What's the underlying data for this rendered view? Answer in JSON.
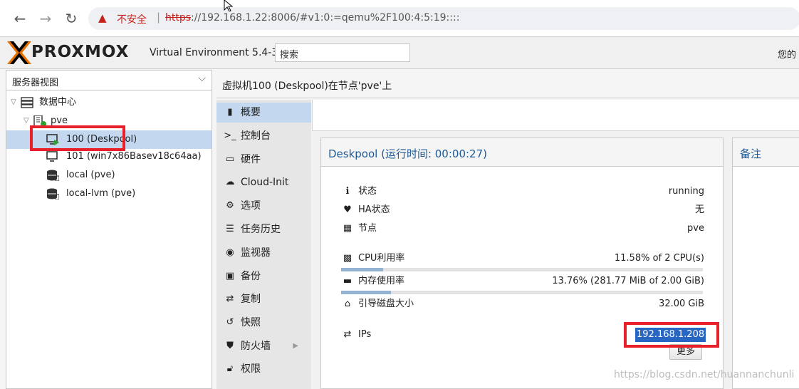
{
  "browser": {
    "back_icon": "←",
    "forward_icon": "→",
    "reload_icon": "↻",
    "insecure_label": "不安全",
    "url_scheme": "https",
    "url_rest": "://192.168.1.22:8006/#v1:0:=qemu%2F100:4:5:19::::"
  },
  "header": {
    "logo": "PROXMOX",
    "version": "Virtual Environment 5.4-3",
    "search_placeholder": "搜索",
    "user_label": "您的"
  },
  "tree": {
    "view_label": "服务器视图",
    "items": [
      {
        "label": "数据中心",
        "icon": "datacenter-icon"
      },
      {
        "label": "pve",
        "icon": "node-icon"
      },
      {
        "label": "100 (Deskpool)",
        "icon": "vm-running-icon"
      },
      {
        "label": "101 (win7x86Basev18c64aa)",
        "icon": "vm-icon"
      },
      {
        "label": "local (pve)",
        "icon": "storage-icon"
      },
      {
        "label": "local-lvm (pve)",
        "icon": "storage-icon"
      }
    ]
  },
  "content": {
    "title": "虚拟机100 (Deskpool)在节点'pve'上"
  },
  "subnav": [
    {
      "label": "概要",
      "icon": "book-icon"
    },
    {
      "label": "控制台",
      "icon": "terminal-icon"
    },
    {
      "label": "硬件",
      "icon": "monitor-icon"
    },
    {
      "label": "Cloud-Init",
      "icon": "cloud-icon"
    },
    {
      "label": "选项",
      "icon": "gear-icon"
    },
    {
      "label": "任务历史",
      "icon": "list-icon"
    },
    {
      "label": "监视器",
      "icon": "eye-icon"
    },
    {
      "label": "备份",
      "icon": "floppy-icon"
    },
    {
      "label": "复制",
      "icon": "retweet-icon"
    },
    {
      "label": "快照",
      "icon": "history-icon"
    },
    {
      "label": "防火墙",
      "icon": "shield-icon"
    },
    {
      "label": "权限",
      "icon": "unlock-icon"
    }
  ],
  "status": {
    "header": "Deskpool (运行时间: 00:00:27)",
    "rows": [
      {
        "label": "状态",
        "value": "running",
        "icon": "info-icon"
      },
      {
        "label": "HA状态",
        "value": "无",
        "icon": "heartbeat-icon"
      },
      {
        "label": "节点",
        "value": "pve",
        "icon": "building-icon"
      },
      {
        "label": "CPU利用率",
        "value": "11.58% of 2 CPU(s)",
        "icon": "cpu-icon"
      },
      {
        "label": "内存使用率",
        "value": "13.76% (281.77 MiB of 2.00 GiB)",
        "icon": "memory-icon"
      },
      {
        "label": "引导磁盘大小",
        "value": "32.00 GiB",
        "icon": "hdd-icon"
      },
      {
        "label": "IPs",
        "value": "",
        "icon": "exchange-icon"
      }
    ],
    "cpu_fraction": 0.1158,
    "mem_fraction": 0.1376,
    "ip": "192.168.1.208",
    "more_label": "更多"
  },
  "notes": {
    "header": "备注"
  },
  "watermark": "https://blog.csdn.net/huannanchunli",
  "colors": {
    "accent": "#1e5a96",
    "selected": "#c3d7ee",
    "highlight": "#e8202a",
    "ip_selection": "#2866c4"
  }
}
